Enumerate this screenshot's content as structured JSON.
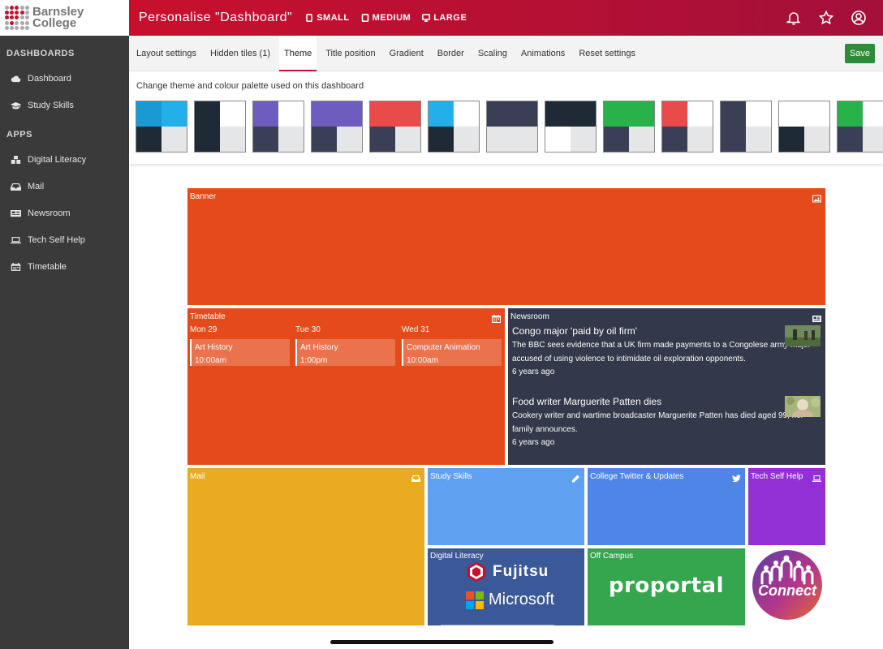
{
  "logo": {
    "line1": "Barnsley",
    "line2": "College"
  },
  "sidebar": {
    "sections": [
      {
        "title": "DASHBOARDS",
        "items": [
          {
            "label": "Dashboard",
            "icon": "cloud-icon"
          },
          {
            "label": "Study Skills",
            "icon": "graduation-cap-icon"
          }
        ]
      },
      {
        "title": "APPS",
        "items": [
          {
            "label": "Digital Literacy",
            "icon": "cubes-icon"
          },
          {
            "label": "Mail",
            "icon": "inbox-icon"
          },
          {
            "label": "Newsroom",
            "icon": "newspaper-icon"
          },
          {
            "label": "Tech Self Help",
            "icon": "laptop-icon"
          },
          {
            "label": "Timetable",
            "icon": "calendar-icon"
          }
        ]
      }
    ]
  },
  "header": {
    "title": "Personalise \"Dashboard\"",
    "sizes": [
      "SMALL",
      "MEDIUM",
      "LARGE"
    ],
    "icons": [
      "bell-icon",
      "star-icon",
      "user-circle-icon"
    ]
  },
  "tabs": [
    {
      "label": "Layout settings",
      "active": false
    },
    {
      "label": "Hidden tiles (1)",
      "active": false
    },
    {
      "label": "Theme",
      "active": true
    },
    {
      "label": "Title position",
      "active": false
    },
    {
      "label": "Gradient",
      "active": false
    },
    {
      "label": "Border",
      "active": false
    },
    {
      "label": "Scaling",
      "active": false
    },
    {
      "label": "Animations",
      "active": false
    },
    {
      "label": "Reset settings",
      "active": false
    }
  ],
  "save_label": "Save",
  "theme": {
    "description": "Change theme and colour palette used on this dashboard",
    "swatches": [
      [
        "#1a9ad3",
        "#23b0ea",
        "#1e2a36",
        "#e4e6e8"
      ],
      [
        "#1e2a36",
        "#ffffff",
        "#1e2a36",
        "#e4e6e8"
      ],
      [
        "#6f5cbf",
        "#ffffff",
        "#3a3f55",
        "#e4e6e8"
      ],
      [
        "#6f5cbf",
        "#6f5cbf",
        "#3a3f55",
        "#e4e6e8"
      ],
      [
        "#e94b4b",
        "#e94b4b",
        "#3a3f55",
        "#e4e6e8"
      ],
      [
        "#23b0ea",
        "#ffffff",
        "#1e2a36",
        "#e4e6e8"
      ],
      [
        "#3a3f55",
        "#3a3f55",
        "#e4e6e8",
        "#e4e6e8"
      ],
      [
        "#1e2a36",
        "#1e2a36",
        "#ffffff",
        "#e4e6e8"
      ],
      [
        "#28b34a",
        "#28b34a",
        "#3a3f55",
        "#e4e6e8"
      ],
      [
        "#e94b4b",
        "#ffffff",
        "#3a3f55",
        "#e4e6e8"
      ],
      [
        "#3a3f55",
        "#ffffff",
        "#3a3f55",
        "#e4e6e8"
      ],
      [
        "#ffffff",
        "#ffffff",
        "#1e2a36",
        "#e4e6e8"
      ],
      [
        "#28b34a",
        "#ffffff",
        "#3a3f55",
        "#e4e6e8"
      ]
    ]
  },
  "tiles": {
    "banner": {
      "title": "Banner",
      "icon": "image-icon",
      "color": "#e54b1a"
    },
    "timetable": {
      "title": "Timetable",
      "icon": "calendar-icon",
      "days": [
        {
          "day": "Mon 29",
          "event": "Art History",
          "time": "10:00am"
        },
        {
          "day": "Tue 30",
          "event": "Art History",
          "time": "1:00pm"
        },
        {
          "day": "Wed 31",
          "event": "Computer Animation",
          "time": "10:00am"
        }
      ]
    },
    "newsroom": {
      "title": "Newsroom",
      "icon": "newspaper-icon",
      "items": [
        {
          "headline": "Congo major 'paid by oil firm'",
          "body": "The BBC sees evidence that a UK firm made payments to a Congolese army major accused of using violence to intimidate oil exploration opponents.",
          "age": "6 years ago"
        },
        {
          "headline": "Food writer Marguerite Patten dies",
          "body": "Cookery writer and wartime broadcaster Marguerite Patten has died aged 99, her family announces.",
          "age": "6 years ago"
        }
      ]
    },
    "mail": {
      "title": "Mail",
      "icon": "inbox-icon"
    },
    "study_skills": {
      "title": "Study Skills",
      "icon": "pencil-icon"
    },
    "twitter": {
      "title": "College Twitter & Updates",
      "icon": "twitter-icon"
    },
    "tech_help": {
      "title": "Tech Self Help",
      "icon": "laptop-icon"
    },
    "digital_literacy": {
      "title": "Digital Literacy",
      "brand1": "Fujitsu",
      "brand2": "Microsoft"
    },
    "off_campus": {
      "title": "Off Campus",
      "brand": "proportal"
    },
    "connect": {
      "brand": "Connect"
    }
  }
}
